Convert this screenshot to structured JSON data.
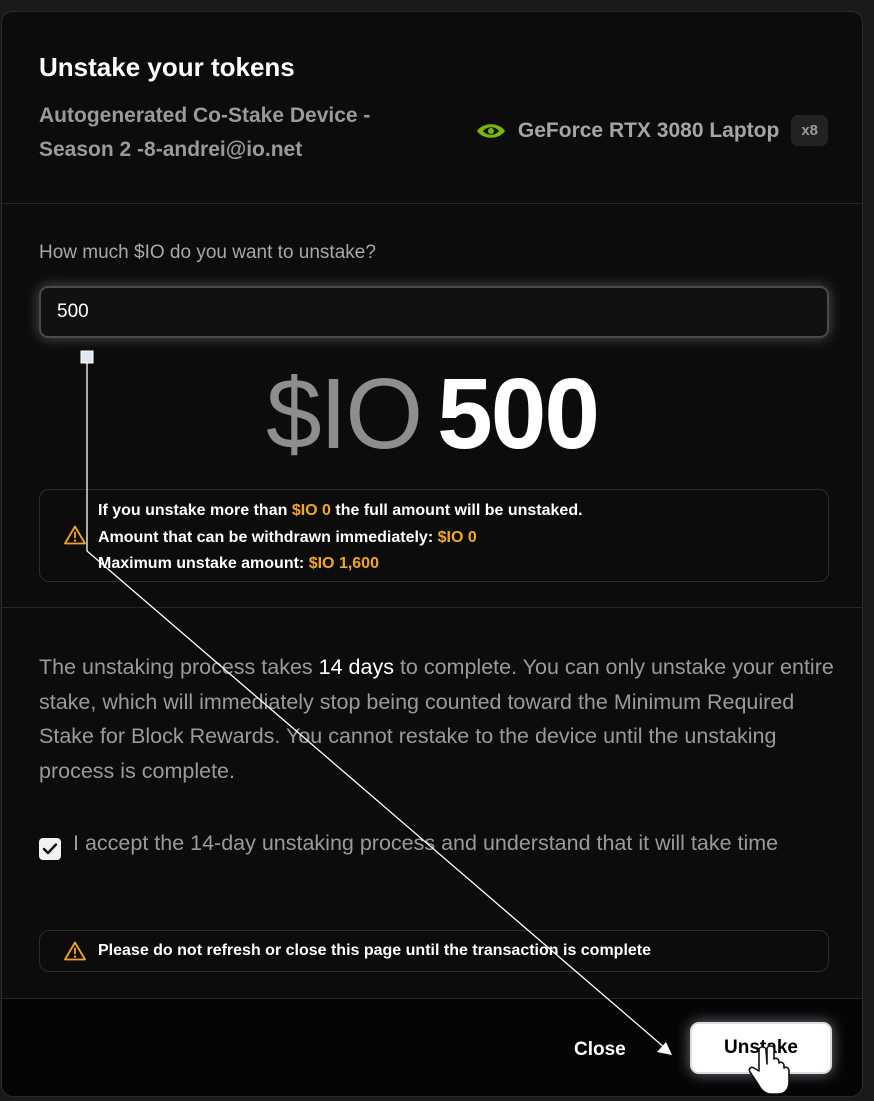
{
  "modal": {
    "title": "Unstake your tokens",
    "device_name": "Autogenerated Co-Stake Device - Season 2 -8-andrei@io.net",
    "gpu": {
      "icon": "nvidia-icon",
      "name": "GeForce RTX 3080 Laptop",
      "count": "x8"
    }
  },
  "amount": {
    "question": "How much $IO do you want to unstake?",
    "input_value": "500",
    "currency": "$IO",
    "display_value": "500"
  },
  "warning": {
    "icon": "warning-icon",
    "line1_prefix": "If you unstake more than ",
    "line1_value": "$IO 0",
    "line1_suffix": " the full amount will be unstaked.",
    "line2_prefix": "Amount that can be withdrawn immediately: ",
    "line2_value": "$IO 0",
    "line3_prefix": "Maximum unstake amount: ",
    "line3_value": "$IO 1,600"
  },
  "info": {
    "text_before": "The unstaking process takes ",
    "highlight": "14 days",
    "text_after": " to complete. You can only unstake your entire stake, which will immediately stop being counted toward the Minimum Required Stake for Block Rewards. You cannot restake to the device until the unstaking process is complete."
  },
  "accept": {
    "checked": true,
    "label": "I accept the 14-day unstaking process and understand that it will take time"
  },
  "notice": {
    "icon": "warning-icon",
    "text": "Please do not refresh or close this page until the transaction is complete"
  },
  "footer": {
    "close_label": "Close",
    "unstake_label": "Unstake"
  },
  "colors": {
    "accent_orange": "#f3a623",
    "nvidia_green": "#76b900",
    "background": "#0c0c0c"
  }
}
